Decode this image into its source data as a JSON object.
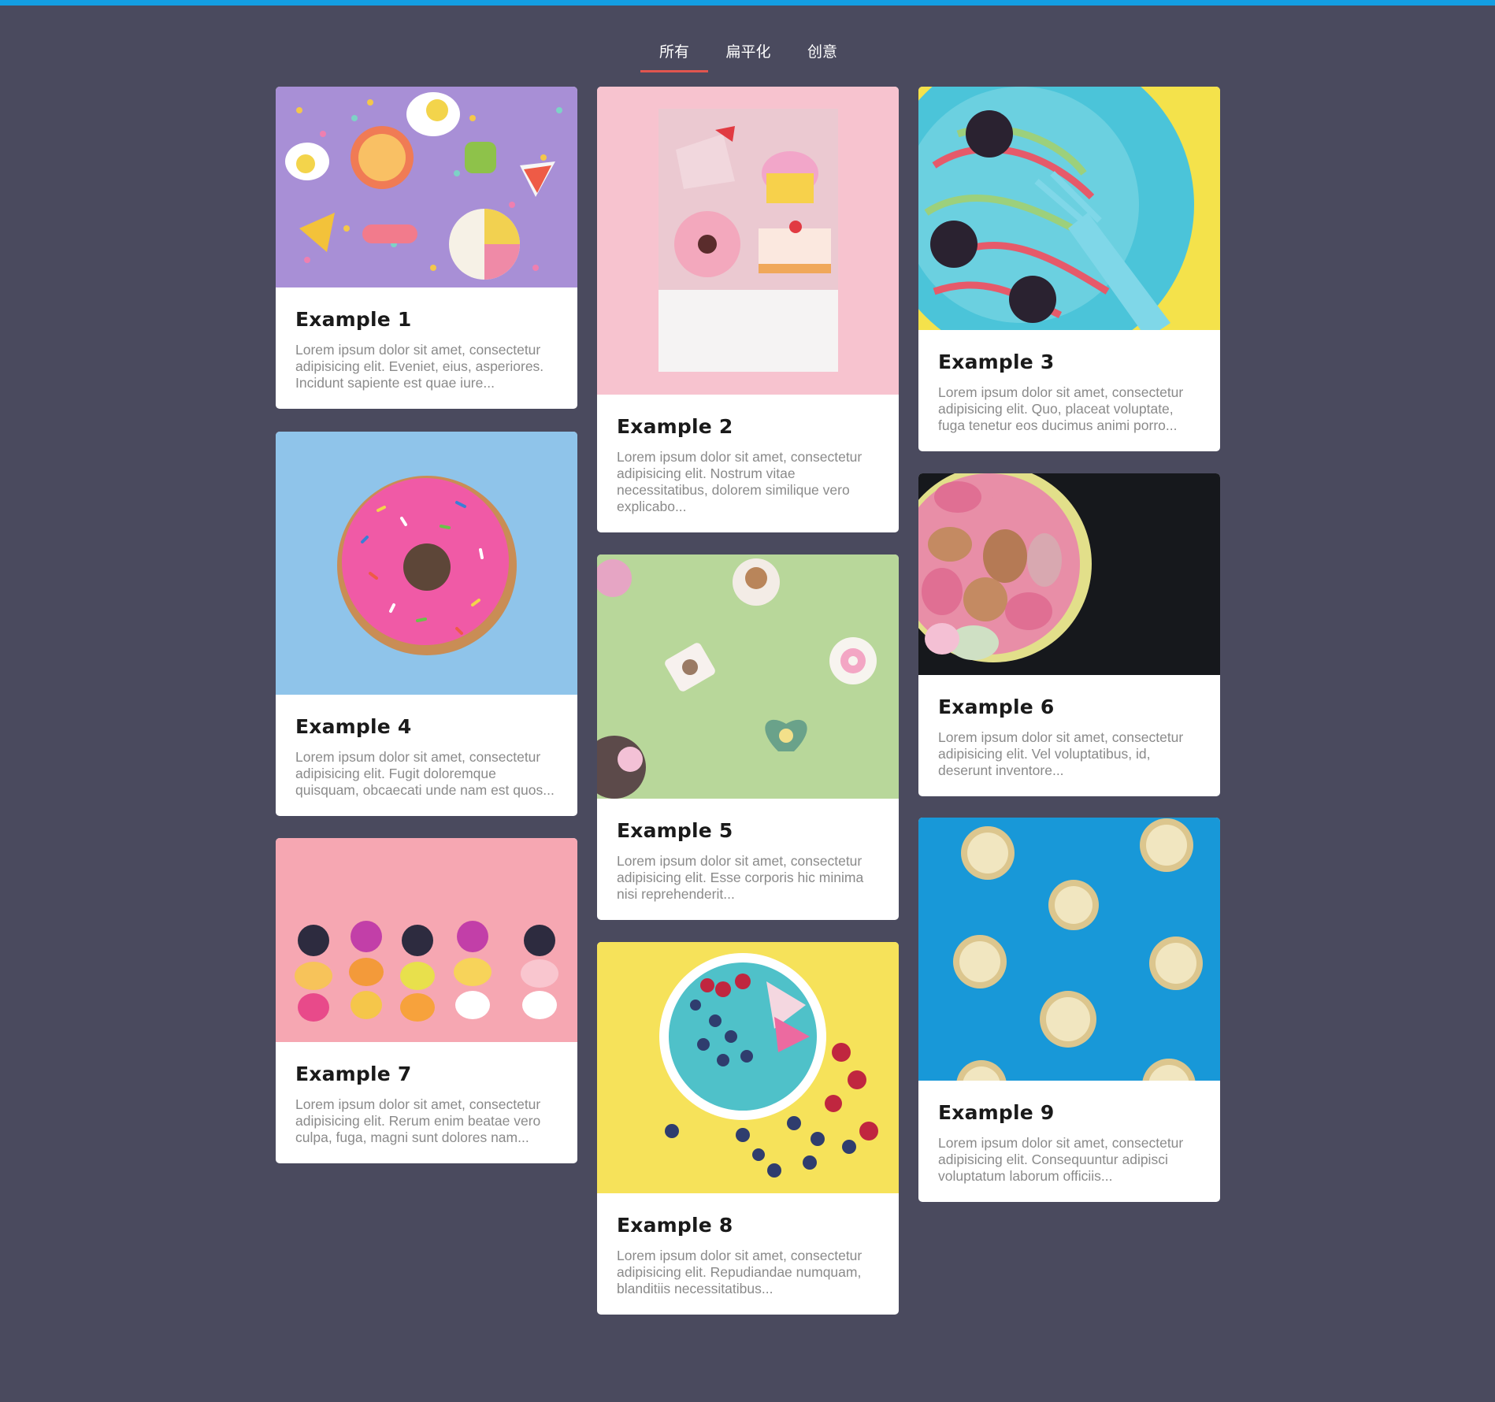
{
  "tabs": [
    {
      "label": "所有",
      "active": true
    },
    {
      "label": "扁平化",
      "active": false
    },
    {
      "label": "创意",
      "active": false
    }
  ],
  "colors": {
    "background": "#4a4a5e",
    "top_bar": "#139ee2",
    "tab_underline": "#e0554f"
  },
  "cards": [
    {
      "title": "Example 1",
      "text": "Lorem ipsum dolor sit amet, consectetur adipisicing elit. Eveniet, eius, asperiores. Incidunt sapiente est quae iure...",
      "image": "sweets-on-purple"
    },
    {
      "title": "Example 2",
      "text": "Lorem ipsum dolor sit amet, consectetur adipisicing elit. Nostrum vitae necessitatibus, dolorem similique vero explicabo...",
      "image": "erasers-on-pink"
    },
    {
      "title": "Example 3",
      "text": "Lorem ipsum dolor sit amet, consectetur adipisicing elit. Quo, placeat voluptate, fuga tenetur eos ducimus animi porro...",
      "image": "candy-bowl-fork"
    },
    {
      "title": "Example 4",
      "text": "Lorem ipsum dolor sit amet, consectetur adipisicing elit. Fugit doloremque quisquam, obcaecati unde nam est quos...",
      "image": "pink-donut"
    },
    {
      "title": "Example 5",
      "text": "Lorem ipsum dolor sit amet, consectetur adipisicing elit. Esse corporis hic minima nisi reprehenderit...",
      "image": "candies-on-green"
    },
    {
      "title": "Example 6",
      "text": "Lorem ipsum dolor sit amet, consectetur adipisicing elit. Vel voluptatibus, id, deserunt inventore...",
      "image": "macarons-bowl"
    },
    {
      "title": "Example 7",
      "text": "Lorem ipsum dolor sit amet, consectetur adipisicing elit. Rerum enim beatae vero culpa, fuga, magni sunt dolores nam...",
      "image": "gummy-skewers"
    },
    {
      "title": "Example 8",
      "text": "Lorem ipsum dolor sit amet, consectetur adipisicing elit. Repudiandae numquam, blanditiis necessitatibus...",
      "image": "smoothie-bowl"
    },
    {
      "title": "Example 9",
      "text": "Lorem ipsum dolor sit amet, consectetur adipisicing elit. Consequuntur adipisci voluptatum laborum officiis...",
      "image": "banana-slices"
    }
  ]
}
